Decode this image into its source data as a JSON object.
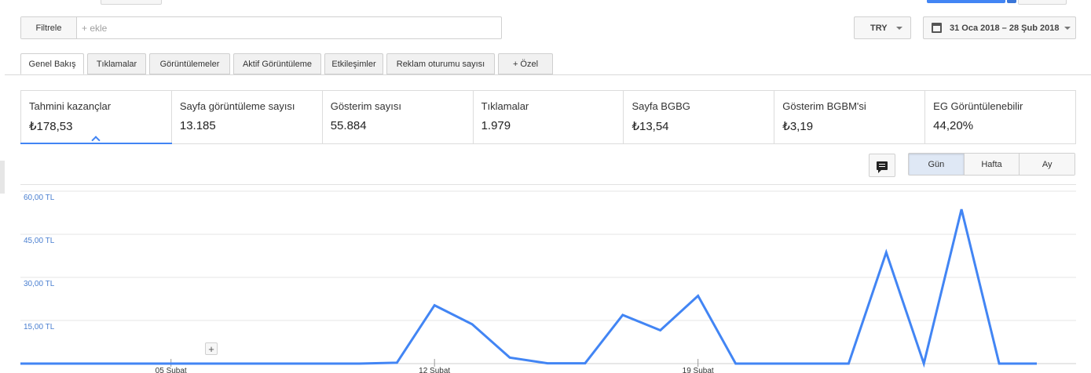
{
  "filter": {
    "label": "Filtrele",
    "placeholder": "+ ekle"
  },
  "currency": {
    "value": "TRY"
  },
  "date_range": {
    "label": "31 Oca 2018 – 28 Şub 2018"
  },
  "tabs": [
    {
      "label": "Genel Bakış",
      "active": true
    },
    {
      "label": "Tıklamalar"
    },
    {
      "label": "Görüntülemeler"
    },
    {
      "label": "Aktif Görüntüleme"
    },
    {
      "label": "Etkileşimler"
    },
    {
      "label": "Reklam oturumu sayısı"
    },
    {
      "label": "+  Özel"
    }
  ],
  "metrics": [
    {
      "name": "Tahmini kazançlar",
      "value": "₺178,53",
      "active": true
    },
    {
      "name": "Sayfa görüntüleme sayısı",
      "value": "13.185"
    },
    {
      "name": "Gösterim sayısı",
      "value": "55.884"
    },
    {
      "name": "Tıklamalar",
      "value": "1.979"
    },
    {
      "name": "Sayfa BGBG",
      "value": "₺13,54"
    },
    {
      "name": "Gösterim BGBM'si",
      "value": "₺3,19"
    },
    {
      "name": "EG Görüntülenebilir",
      "value": "44,20%"
    }
  ],
  "granularity": {
    "options": [
      "Gün",
      "Hafta",
      "Ay"
    ],
    "selected": "Gün"
  },
  "icons": {
    "comment": "comment-icon",
    "calendar": "calendar-icon",
    "add_annotation": "plus-icon"
  },
  "colors": {
    "accent": "#4285f4",
    "axis_label": "#4a7fd0"
  },
  "chart_data": {
    "type": "line",
    "ylim": [
      0,
      60
    ],
    "yticks": [
      15,
      30,
      45,
      60
    ],
    "ytick_labels": [
      "15,00 TL",
      "30,00 TL",
      "45,00 TL",
      "60,00 TL"
    ],
    "x_ticks": [
      {
        "day": 5,
        "label": "05 Şubat"
      },
      {
        "day": 12,
        "label": "12 Şubat"
      },
      {
        "day": 19,
        "label": "19 Şubat"
      }
    ],
    "series": [
      {
        "x": [
          1,
          2,
          3,
          4,
          5,
          6,
          7,
          8,
          9,
          10,
          11,
          12,
          13,
          14,
          15,
          16,
          17,
          18,
          19,
          20,
          21,
          22,
          23,
          24,
          25,
          26,
          27,
          28
        ],
        "values": [
          0,
          0,
          0,
          0,
          0,
          0,
          0,
          0,
          0,
          0,
          0.3,
          20.3,
          13.7,
          2.1,
          0.1,
          0.1,
          16.9,
          11.6,
          23.6,
          0,
          0,
          0,
          0,
          38.7,
          0,
          53.7,
          0,
          0
        ]
      }
    ]
  }
}
